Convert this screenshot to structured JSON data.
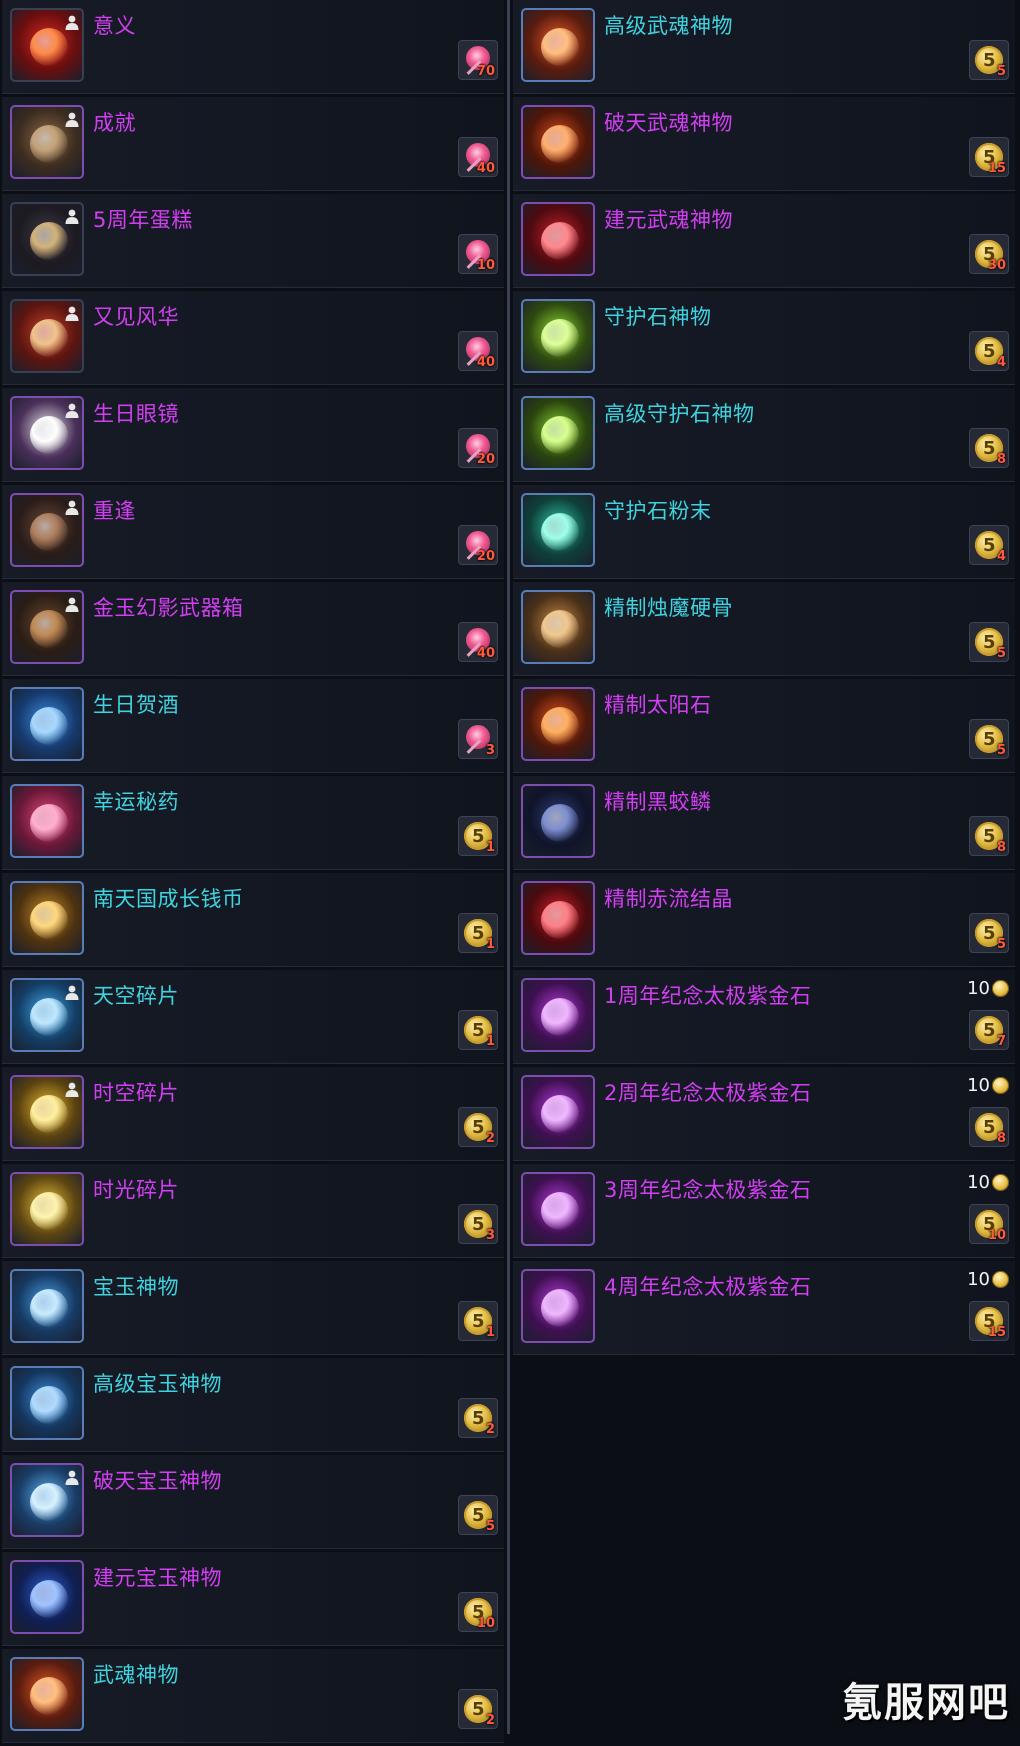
{
  "left_items": [
    {
      "name": "意义",
      "color": "purple",
      "bound": true,
      "token": "seal",
      "qty": "70",
      "c1": "#d62a26",
      "c2": "#6a0e0e",
      "c3": "#ff8c4a",
      "rim": "rim-gray",
      "icon": "red-robe-icon"
    },
    {
      "name": "成就",
      "color": "purple",
      "bound": true,
      "token": "seal",
      "qty": "40",
      "c1": "#8a6b48",
      "c2": "#3d2c20",
      "c3": "#c4a37a",
      "rim": "rim-purple",
      "icon": "feathered-hat-icon"
    },
    {
      "name": "5周年蛋糕",
      "color": "purple",
      "bound": true,
      "token": "seal",
      "qty": "10",
      "c1": "#3f3a45",
      "c2": "#1d1a22",
      "c3": "#d3b37a",
      "rim": "rim-gray",
      "icon": "anniversary-cake-icon"
    },
    {
      "name": "又见风华",
      "color": "purple",
      "bound": true,
      "token": "seal",
      "qty": "40",
      "c1": "#c4422a",
      "c2": "#5c1510",
      "c3": "#f0c48c",
      "rim": "rim-gray",
      "icon": "ornate-coat-icon"
    },
    {
      "name": "生日眼镜",
      "color": "purple",
      "bound": true,
      "token": "seal",
      "qty": "20",
      "c1": "#e6e6e6",
      "c2": "#4a2f5a",
      "c3": "#ffffff",
      "rim": "rim-purple",
      "icon": "birthday-glasses-icon"
    },
    {
      "name": "重逢",
      "color": "purple",
      "bound": true,
      "token": "seal",
      "qty": "20",
      "c1": "#6a4a3a",
      "c2": "#2a1c18",
      "c3": "#b08060",
      "rim": "rim-purple",
      "icon": "hair-accessory-icon"
    },
    {
      "name": "金玉幻影武器箱",
      "color": "purple",
      "bound": true,
      "token": "seal",
      "qty": "40",
      "c1": "#6b4a30",
      "c2": "#2b1d15",
      "c3": "#c08a55",
      "rim": "rim-purple",
      "icon": "weapon-chest-icon"
    },
    {
      "name": "生日贺酒",
      "color": "cyan",
      "bound": false,
      "token": "seal",
      "qty": "3",
      "c1": "#3a8ee0",
      "c2": "#163a6e",
      "c3": "#a8d8ff",
      "rim": "rim-blue",
      "icon": "celebration-wine-icon"
    },
    {
      "name": "幸运秘药",
      "color": "cyan",
      "bound": false,
      "token": "coin",
      "qty": "1",
      "c1": "#e0487a",
      "c2": "#6a1838",
      "c3": "#ffb0d0",
      "rim": "rim-blue",
      "icon": "luck-potion-icon"
    },
    {
      "name": "南天国成长钱币",
      "color": "cyan",
      "bound": false,
      "token": "coin",
      "qty": "1",
      "c1": "#c28a2a",
      "c2": "#4e3210",
      "c3": "#ffd880",
      "rim": "rim-blue",
      "icon": "growth-coin-icon"
    },
    {
      "name": "天空碎片",
      "color": "cyan",
      "bound": true,
      "token": "coin",
      "qty": "1",
      "c1": "#3fa7ea",
      "c2": "#143e66",
      "c3": "#bfe8ff",
      "rim": "rim-blue",
      "icon": "sky-shard-icon"
    },
    {
      "name": "时空碎片",
      "color": "purple",
      "bound": true,
      "token": "coin",
      "qty": "2",
      "c1": "#e8b830",
      "c2": "#5a4210",
      "c3": "#fff0a0",
      "rim": "rim-purple",
      "icon": "time-space-shard-icon"
    },
    {
      "name": "时光碎片",
      "color": "purple",
      "bound": false,
      "token": "coin",
      "qty": "3",
      "c1": "#eac03a",
      "c2": "#5e4612",
      "c3": "#fff4b0",
      "rim": "rim-purple",
      "icon": "time-shard-icon"
    },
    {
      "name": "宝玉神物",
      "color": "cyan",
      "bound": false,
      "token": "coin",
      "qty": "1",
      "c1": "#4a9ee8",
      "c2": "#163a62",
      "c3": "#c8ecff",
      "rim": "rim-blue",
      "icon": "gem-relic-icon"
    },
    {
      "name": "高级宝玉神物",
      "color": "cyan",
      "bound": false,
      "token": "coin",
      "qty": "2",
      "c1": "#3f8fe0",
      "c2": "#14365e",
      "c3": "#b0dcff",
      "rim": "rim-blue",
      "icon": "advanced-gem-relic-icon"
    },
    {
      "name": "破天宝玉神物",
      "color": "purple",
      "bound": true,
      "token": "coin",
      "qty": "5",
      "c1": "#5ab0f0",
      "c2": "#1a3c66",
      "c3": "#d8f2ff",
      "rim": "rim-purple",
      "icon": "sky-breaking-gem-relic-icon"
    },
    {
      "name": "建元宝玉神物",
      "color": "purple",
      "bound": false,
      "token": "coin",
      "qty": "10",
      "c1": "#2e62d8",
      "c2": "#101e52",
      "c3": "#a0c4ff",
      "rim": "rim-purple",
      "icon": "founding-gem-relic-icon"
    },
    {
      "name": "武魂神物",
      "color": "cyan",
      "bound": false,
      "token": "coin",
      "qty": "2",
      "c1": "#e85a2a",
      "c2": "#5a1c0e",
      "c3": "#ffc080",
      "rim": "rim-blue",
      "icon": "martial-soul-relic-icon"
    }
  ],
  "right_items": [
    {
      "name": "高级武魂神物",
      "color": "cyan",
      "bound": false,
      "token": "coin",
      "qty": "5",
      "c1": "#e8582a",
      "c2": "#5a1c0e",
      "c3": "#ffc080",
      "rim": "rim-blue",
      "icon": "advanced-martial-soul-relic-icon",
      "extra": null
    },
    {
      "name": "破天武魂神物",
      "color": "purple",
      "bound": false,
      "token": "coin",
      "qty": "15",
      "c1": "#d84a1e",
      "c2": "#4e1608",
      "c3": "#ffb070",
      "rim": "rim-purple",
      "icon": "sky-breaking-martial-relic-icon",
      "extra": null
    },
    {
      "name": "建元武魂神物",
      "color": "purple",
      "bound": false,
      "token": "coin",
      "qty": "30",
      "c1": "#c4202a",
      "c2": "#4e0a10",
      "c3": "#ff8a90",
      "rim": "rim-purple",
      "icon": "founding-martial-relic-icon",
      "extra": null
    },
    {
      "name": "守护石神物",
      "color": "cyan",
      "bound": false,
      "token": "coin",
      "qty": "4",
      "c1": "#8ed834",
      "c2": "#2e4a10",
      "c3": "#e0ff9a",
      "rim": "rim-blue",
      "icon": "guardian-stone-relic-icon",
      "extra": null
    },
    {
      "name": "高级守护石神物",
      "color": "cyan",
      "bound": false,
      "token": "coin",
      "qty": "8",
      "c1": "#84cc30",
      "c2": "#2a440e",
      "c3": "#d8ff90",
      "rim": "rim-blue",
      "icon": "advanced-guardian-relic-icon",
      "extra": null
    },
    {
      "name": "守护石粉末",
      "color": "cyan",
      "bound": false,
      "token": "coin",
      "qty": "4",
      "c1": "#2ec4a8",
      "c2": "#0e4038",
      "c3": "#a0ffe8",
      "rim": "rim-blue",
      "icon": "guardian-powder-icon",
      "extra": null
    },
    {
      "name": "精制烛魔硬骨",
      "color": "cyan",
      "bound": false,
      "token": "coin",
      "qty": "5",
      "c1": "#c48a4a",
      "c2": "#4a3018",
      "c3": "#f0c890",
      "rim": "rim-blue",
      "icon": "demon-bone-icon",
      "extra": null
    },
    {
      "name": "精制太阳石",
      "color": "purple",
      "bound": false,
      "token": "coin",
      "qty": "5",
      "c1": "#e0541e",
      "c2": "#4e180a",
      "c3": "#ffb060",
      "rim": "rim-purple",
      "icon": "sun-stone-icon",
      "extra": null
    },
    {
      "name": "精制黑蛟鳞",
      "color": "purple",
      "bound": false,
      "token": "coin",
      "qty": "8",
      "c1": "#2e3e78",
      "c2": "#10142a",
      "c3": "#8090d0",
      "rim": "rim-purple",
      "icon": "black-dragon-scale-icon",
      "extra": null
    },
    {
      "name": "精制赤流结晶",
      "color": "purple",
      "bound": false,
      "token": "coin",
      "qty": "5",
      "c1": "#d0202a",
      "c2": "#4a0a0e",
      "c3": "#ff8088",
      "rim": "rim-purple",
      "icon": "red-flow-crystal-icon",
      "extra": null
    },
    {
      "name": "1周年纪念太极紫金石",
      "color": "purple",
      "bound": false,
      "token": "coin",
      "qty": "7",
      "c1": "#b83ae0",
      "c2": "#3e1050",
      "c3": "#f0b8ff",
      "rim": "rim-purple",
      "icon": "taiji-purple-stone-icon",
      "extra": "10"
    },
    {
      "name": "2周年纪念太极紫金石",
      "color": "purple",
      "bound": false,
      "token": "coin",
      "qty": "8",
      "c1": "#b83ae0",
      "c2": "#3e1050",
      "c3": "#f0b8ff",
      "rim": "rim-purple",
      "icon": "taiji-purple-stone-icon",
      "extra": "10"
    },
    {
      "name": "3周年纪念太极紫金石",
      "color": "purple",
      "bound": false,
      "token": "coin",
      "qty": "10",
      "c1": "#b83ae0",
      "c2": "#3e1050",
      "c3": "#f0b8ff",
      "rim": "rim-purple",
      "icon": "taiji-purple-stone-icon",
      "extra": "10"
    },
    {
      "name": "4周年纪念太极紫金石",
      "color": "purple",
      "bound": false,
      "token": "coin",
      "qty": "15",
      "c1": "#b83ae0",
      "c2": "#3e1050",
      "c3": "#f0b8ff",
      "rim": "rim-purple",
      "icon": "taiji-purple-stone-icon",
      "extra": "10"
    }
  ],
  "watermark": "氪服网吧",
  "colors": {
    "purple": "#d23ff2",
    "cyan": "#3fd3e0",
    "quantity": "#ff5a3c",
    "background": "#0b0e15"
  }
}
